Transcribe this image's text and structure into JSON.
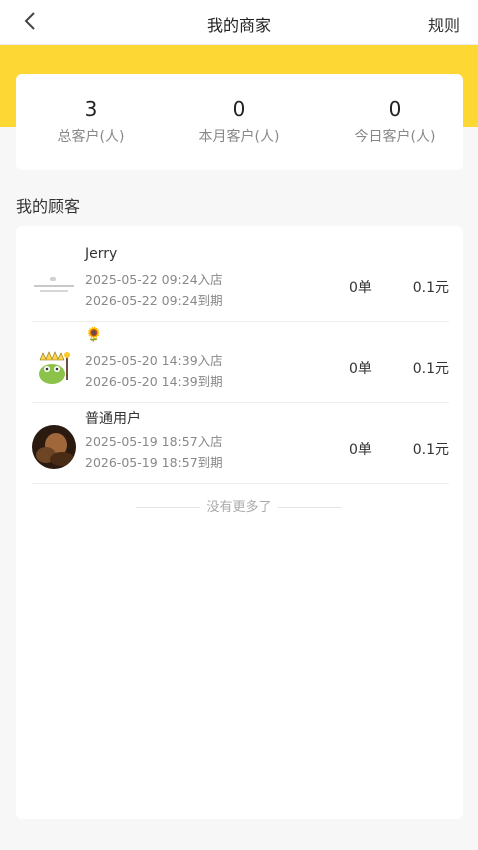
{
  "header": {
    "title": "我的商家",
    "rules_label": "规则"
  },
  "stats": [
    {
      "value": "3",
      "label": "总客户(人)"
    },
    {
      "value": "0",
      "label": "本月客户(人)"
    },
    {
      "value": "0",
      "label": "今日客户(人)"
    }
  ],
  "customers_section": {
    "title": "我的顾客"
  },
  "customers": [
    {
      "name": "Jerry",
      "joined": "2025-05-22 09:24入店",
      "expires": "2026-05-22 09:24到期",
      "orders": "0单",
      "amount": "0.1元",
      "avatar": "placeholder-image"
    },
    {
      "name": "🌻",
      "joined": "2025-05-20 14:39入店",
      "expires": "2026-05-20 14:39到期",
      "orders": "0单",
      "amount": "0.1元",
      "avatar": "cartoon-character"
    },
    {
      "name": "普通用户",
      "joined": "2025-05-19 18:57入店",
      "expires": "2026-05-19 18:57到期",
      "orders": "0单",
      "amount": "0.1元",
      "avatar": "dark-photo"
    }
  ],
  "footer": {
    "no_more": "没有更多了"
  },
  "colors": {
    "accent": "#fdd835",
    "background": "#f7f7f7"
  }
}
